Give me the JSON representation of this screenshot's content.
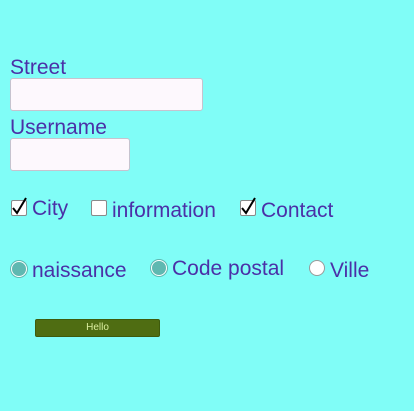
{
  "form": {
    "street_label": "Street",
    "street_value": "",
    "username_label": "Username",
    "username_value": ""
  },
  "checkboxes": [
    {
      "label": "City",
      "checked": true
    },
    {
      "label": "information",
      "checked": false
    },
    {
      "label": "Contact",
      "checked": true
    }
  ],
  "radios": [
    {
      "label": "naissance",
      "selected": true
    },
    {
      "label": "Code postal",
      "selected": true
    },
    {
      "label": "Ville",
      "selected": false
    }
  ],
  "button": {
    "label": "Hello"
  },
  "colors": {
    "background": "#80fdf7",
    "text": "#4b30a7",
    "button_bg": "#4f6d12",
    "button_text": "#dcefa0",
    "radio_selected": "#5fb8b1"
  }
}
